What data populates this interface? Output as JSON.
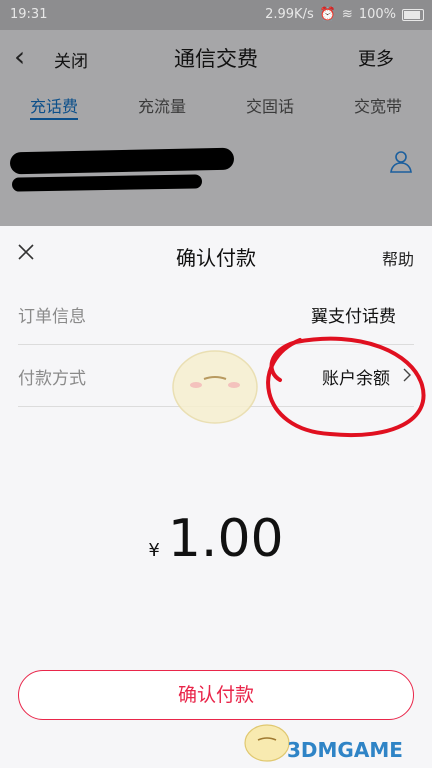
{
  "status": {
    "time": "19:31",
    "speed": "2.99K/s",
    "battery": "100%"
  },
  "header": {
    "close_label": "关闭",
    "title": "通信交费",
    "more_label": "更多",
    "tabs": [
      {
        "label": "充话费",
        "active": true
      },
      {
        "label": "充流量",
        "active": false
      },
      {
        "label": "交固话",
        "active": false
      },
      {
        "label": "交宽带",
        "active": false
      }
    ]
  },
  "sheet": {
    "title": "确认付款",
    "help_label": "帮助",
    "order": {
      "label": "订单信息",
      "value": "翼支付话费"
    },
    "payment": {
      "label": "付款方式",
      "value": "账户余额"
    },
    "amount": {
      "currency": "¥",
      "value": "1.00"
    },
    "confirm_label": "确认付款"
  },
  "colors": {
    "accent": "#e9264a",
    "tab_active": "#0b4f8a",
    "annotation_red": "#e01020"
  }
}
